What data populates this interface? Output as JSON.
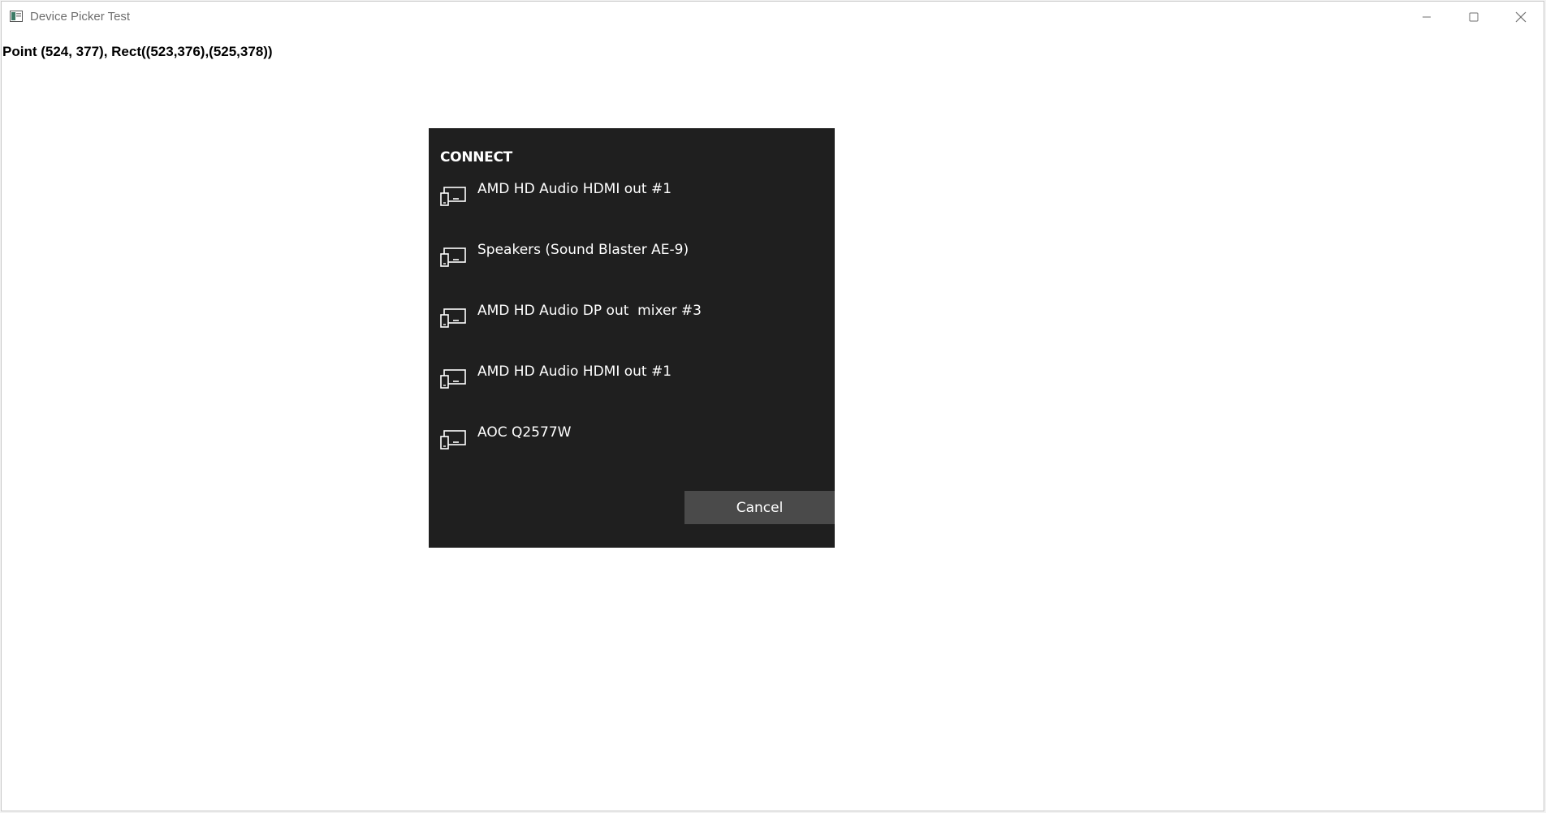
{
  "window": {
    "title": "Device Picker Test",
    "icon": "app-window-icon",
    "controls": {
      "minimize_icon": "minimize-icon",
      "maximize_icon": "maximize-icon",
      "close_icon": "close-icon"
    }
  },
  "status": {
    "text": "Point (524, 377), Rect((523,376),(525,378))"
  },
  "picker": {
    "title": "CONNECT",
    "devices": [
      {
        "label": "AMD HD Audio HDMI out #1",
        "icon": "device-display-icon"
      },
      {
        "label": "Speakers (Sound Blaster AE-9)",
        "icon": "device-display-icon"
      },
      {
        "label": "AMD HD Audio DP out  mixer #3",
        "icon": "device-display-icon"
      },
      {
        "label": "AMD HD Audio HDMI out #1",
        "icon": "device-display-icon"
      },
      {
        "label": "AOC Q2577W",
        "icon": "device-display-icon"
      }
    ],
    "cancel_label": "Cancel"
  },
  "colors": {
    "picker_background": "#1f1f1f",
    "cancel_button": "#4a4a4a",
    "window_background": "#ffffff",
    "title_text": "#6e6e6e"
  }
}
